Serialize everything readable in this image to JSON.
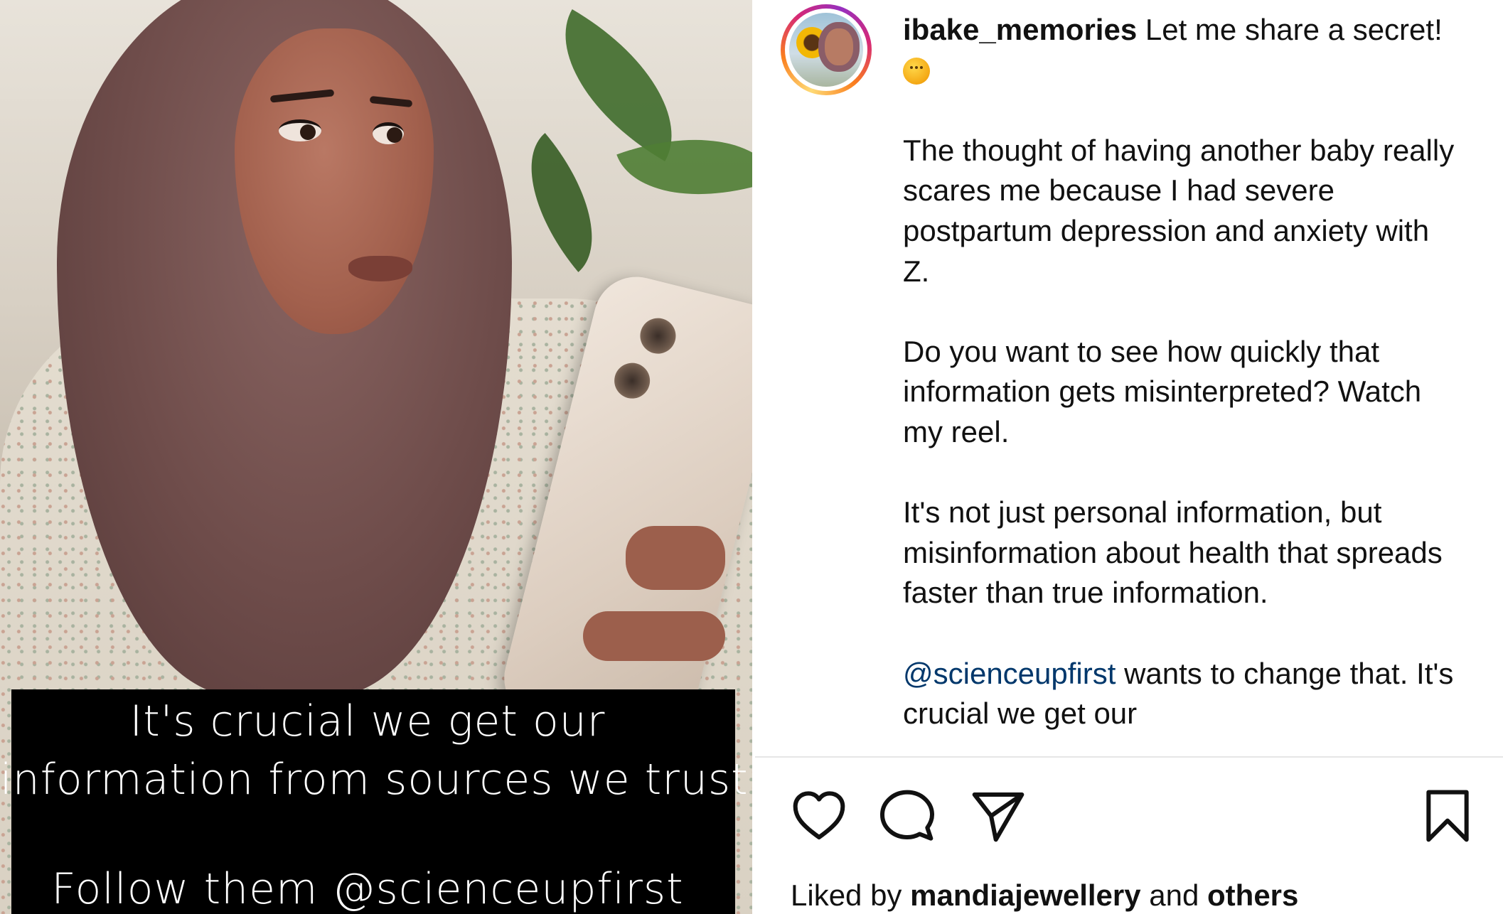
{
  "media": {
    "caption_lines": [
      "It's crucial we get our",
      "information from sources we trust.",
      "Follow them @scienceupfirst"
    ]
  },
  "post": {
    "username": "ibake_memories",
    "caption_intro": " Let me share a secret! ",
    "emoji": "shushing-face-emoji",
    "paragraph_1": "The thought of having another baby really scares me because I had severe postpartum depression and anxiety with Z.",
    "paragraph_2": "Do you want to see how quickly that information gets misinterpreted? Watch my reel.",
    "paragraph_3": "It's not just personal information, but misinformation about health that spreads faster than true information.",
    "mention": "@scienceupfirst",
    "paragraph_4_rest": " wants to change that. It's crucial we get our"
  },
  "actions": {
    "like_icon": "heart-icon",
    "comment_icon": "comment-icon",
    "share_icon": "paper-plane-icon",
    "save_icon": "bookmark-icon"
  },
  "likes": {
    "prefix": "Liked by ",
    "user": "mandiajewellery",
    "middle": " and ",
    "others": "others"
  }
}
